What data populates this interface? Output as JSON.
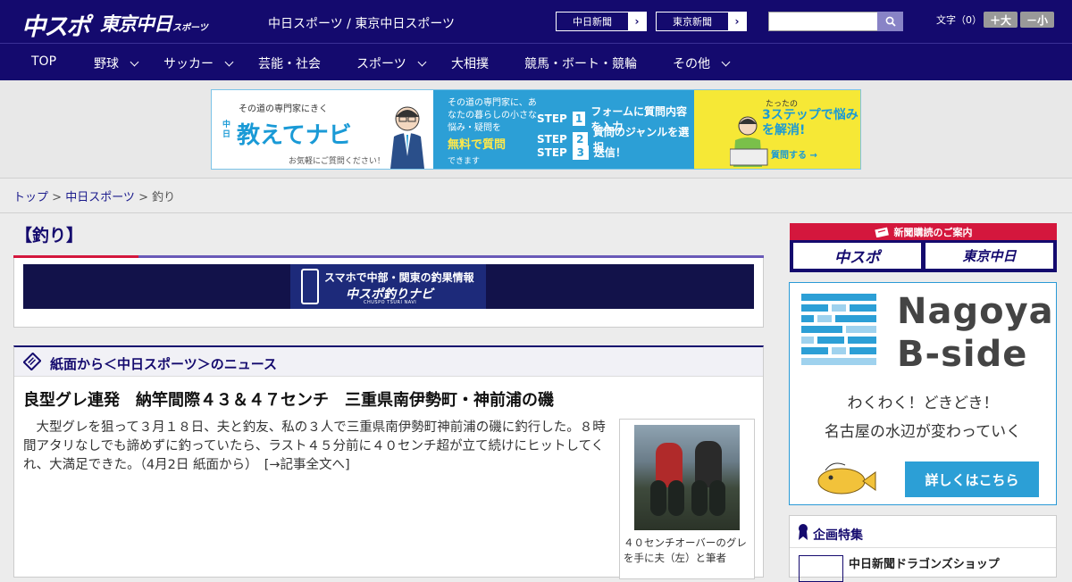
{
  "header": {
    "logo_chuspo": "中スポ",
    "logo_tokyo": "東京中日",
    "logo_tokyo_sub": "スポーツ",
    "site_names": "中日スポーツ / 東京中日スポーツ",
    "paper_links": [
      {
        "label": "中日新聞"
      },
      {
        "label": "東京新聞"
      }
    ],
    "search_placeholder": "",
    "font_size_label": "文字（0）",
    "font_plus": "＋大",
    "font_minus": "－小"
  },
  "nav": {
    "items": [
      {
        "label": "TOP",
        "dropdown": false
      },
      {
        "label": "野球",
        "dropdown": true
      },
      {
        "label": "サッカー",
        "dropdown": true
      },
      {
        "label": "芸能・社会",
        "dropdown": false
      },
      {
        "label": "スポーツ",
        "dropdown": true
      },
      {
        "label": "大相撲",
        "dropdown": false
      },
      {
        "label": "競馬・ボート・競輪",
        "dropdown": false
      },
      {
        "label": "その他",
        "dropdown": true
      }
    ]
  },
  "ad": {
    "left_top": "その道の専門家にきく",
    "left_title": "教えてナビ",
    "left_prefix": "中日",
    "left_bottom": "お気軽にご質問ください！",
    "mid_text": "その道の専門家に、あなたの暮らしの小さな悩み・疑問を",
    "mid_highlight": "無料で質問",
    "mid_bottom": "できます",
    "steps": [
      {
        "n": "1",
        "text": "フォームに質問内容を入力"
      },
      {
        "n": "2",
        "text": "質問のジャンルを選択"
      },
      {
        "n": "3",
        "text": "送信！"
      }
    ],
    "right_top": "たったの",
    "right_title": "3ステップで悩みを解消!",
    "right_cta": "質問する →"
  },
  "breadcrumb": {
    "home": "トップ",
    "section": "中日スポーツ",
    "current": "釣り"
  },
  "page_title": "【釣り】",
  "navi_banner": {
    "line1": "スマホで中部・関東の釣果情報",
    "line2": "中スポ釣りナビ",
    "line3": "CHUSPO TSURI NAVI"
  },
  "news": {
    "heading": "紙面から＜中日スポーツ＞のニュース",
    "article_title": "良型グレ連発　納竿間際４３＆４７センチ　三重県南伊勢町・神前浦の磯",
    "article_body": "大型グレを狙って３月１８日、夫と釣友、私の３人で三重県南伊勢町神前浦の磯に釣行した。８時間アタリなしでも諦めずに釣っていたら、ラスト４５分前に４０センチ超が立て続けにヒットしてくれ、大満足できた。（4月2日 紙面から）",
    "more_link": "[→記事全文へ]",
    "photo_caption": "４０センチオーバーのグレを手に夫（左）と筆者"
  },
  "sidebar": {
    "subscribe_heading": "新聞購読のご案内",
    "subscribe_buttons": [
      "中スポ",
      "東京中日"
    ],
    "bside_title_1": "Nagoya",
    "bside_title_2": "B-side",
    "bside_tag1": "わくわく！どきどき！",
    "bside_tag2": "名古屋の水辺が変わっていく",
    "bside_button": "詳しくはこちら",
    "kikaku_heading": "企画特集",
    "kikaku_item": "中日新聞ドラゴンズショップ"
  },
  "colors": {
    "brand_navy": "#140a6e",
    "accent_red": "#d4173d",
    "accent_blue": "#2c9fd6"
  }
}
